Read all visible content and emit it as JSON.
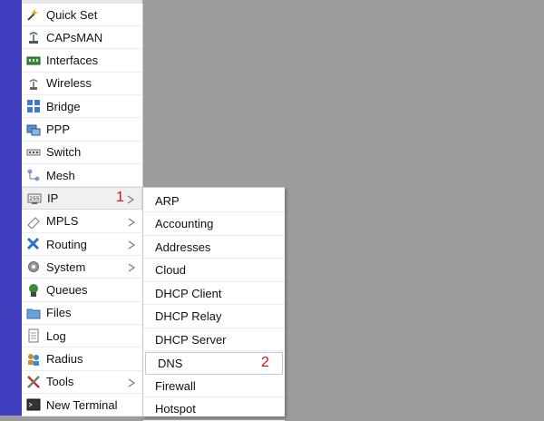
{
  "menu": {
    "items": [
      {
        "label": "Quick Set",
        "icon": "quick-set-icon"
      },
      {
        "label": "CAPsMAN",
        "icon": "capsman-icon"
      },
      {
        "label": "Interfaces",
        "icon": "interfaces-icon"
      },
      {
        "label": "Wireless",
        "icon": "wireless-icon"
      },
      {
        "label": "Bridge",
        "icon": "bridge-icon"
      },
      {
        "label": "PPP",
        "icon": "ppp-icon"
      },
      {
        "label": "Switch",
        "icon": "switch-icon"
      },
      {
        "label": "Mesh",
        "icon": "mesh-icon"
      },
      {
        "label": "IP",
        "icon": "ip-icon",
        "submenu": true,
        "active": true
      },
      {
        "label": "MPLS",
        "icon": "mpls-icon",
        "submenu": true
      },
      {
        "label": "Routing",
        "icon": "routing-icon",
        "submenu": true
      },
      {
        "label": "System",
        "icon": "system-gear-icon",
        "submenu": true
      },
      {
        "label": "Queues",
        "icon": "queues-icon"
      },
      {
        "label": "Files",
        "icon": "folder-icon"
      },
      {
        "label": "Log",
        "icon": "log-icon"
      },
      {
        "label": "Radius",
        "icon": "radius-users-icon"
      },
      {
        "label": "Tools",
        "icon": "tools-icon",
        "submenu": true
      },
      {
        "label": "New Terminal",
        "icon": "terminal-icon"
      }
    ]
  },
  "submenu": {
    "items": [
      {
        "label": "ARP"
      },
      {
        "label": "Accounting"
      },
      {
        "label": "Addresses"
      },
      {
        "label": "Cloud"
      },
      {
        "label": "DHCP Client"
      },
      {
        "label": "DHCP Relay"
      },
      {
        "label": "DHCP Server"
      },
      {
        "label": "DNS",
        "active": true
      },
      {
        "label": "Firewall"
      },
      {
        "label": "Hotspot"
      }
    ]
  },
  "markers": {
    "step1": "1",
    "step2": "2"
  },
  "colors": {
    "sidebar_strip": "#3f3fbf",
    "workspace": "#9c9c9c",
    "marker": "#cc1111"
  }
}
